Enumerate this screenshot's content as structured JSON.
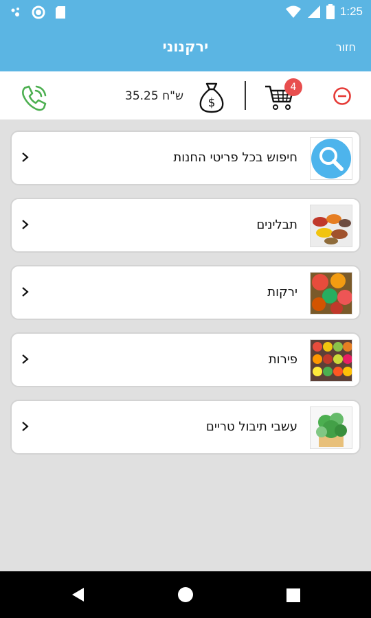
{
  "status": {
    "time": "1:25"
  },
  "appbar": {
    "title": "ירקנוני",
    "back_label": "חזור"
  },
  "toolbar": {
    "price_value": "35.25",
    "price_currency": "ש\"ח",
    "cart_count": "4"
  },
  "list": {
    "items": [
      {
        "label": "חיפוש בכל פריטי החנות",
        "icon": "search-icon"
      },
      {
        "label": "תבלינים",
        "icon": "spices-image"
      },
      {
        "label": "ירקות",
        "icon": "vegetables-image"
      },
      {
        "label": "פירות",
        "icon": "fruits-image"
      },
      {
        "label": "עשבי תיבול טריים",
        "icon": "herbs-image"
      }
    ]
  },
  "colors": {
    "primary": "#5bb5e3",
    "badge": "#e84e4e",
    "phone": "#4caf50",
    "remove": "#e53935"
  }
}
